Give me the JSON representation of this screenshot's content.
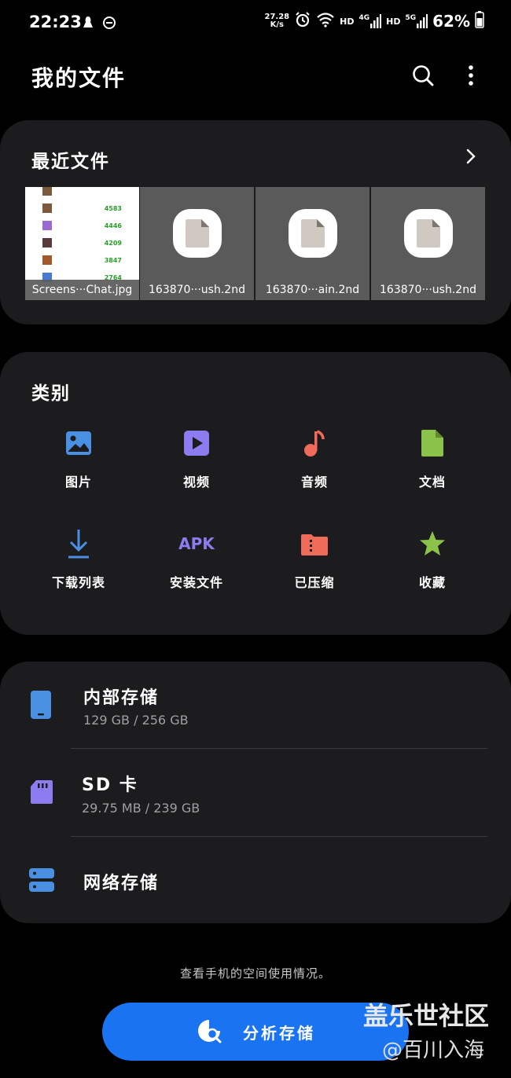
{
  "status": {
    "time": "22:23",
    "net_speed_value": "27.28",
    "net_speed_unit": "K/s",
    "hd1": "HD",
    "sig1": "4G",
    "hd2": "HD",
    "sig2": "5G",
    "battery": "62%"
  },
  "header": {
    "title": "我的文件"
  },
  "recent": {
    "title": "最近文件",
    "files": [
      {
        "name": "Screens···Chat.jpg"
      },
      {
        "name": "163870···ush.2nd"
      },
      {
        "name": "163870···ain.2nd"
      },
      {
        "name": "163870···ush.2nd"
      }
    ],
    "screenshot_scores": [
      "4583",
      "4446",
      "4209",
      "3847",
      "2764"
    ]
  },
  "categories": {
    "title": "类别",
    "items": [
      {
        "label": "图片",
        "icon": "image-icon",
        "color": "#4a90e2"
      },
      {
        "label": "视频",
        "icon": "video-icon",
        "color": "#8b7cf0"
      },
      {
        "label": "音频",
        "icon": "music-icon",
        "color": "#f06b5a"
      },
      {
        "label": "文档",
        "icon": "document-icon",
        "color": "#8bc34a"
      },
      {
        "label": "下载列表",
        "icon": "download-icon",
        "color": "#4a90e2"
      },
      {
        "label": "安装文件",
        "icon": "apk-icon",
        "icon_text": "APK",
        "color": "#8b7cf0"
      },
      {
        "label": "已压缩",
        "icon": "archive-icon",
        "color": "#f06b5a"
      },
      {
        "label": "收藏",
        "icon": "star-icon",
        "color": "#8bc34a"
      }
    ]
  },
  "storage": {
    "internal": {
      "name": "内部存储",
      "usage": "129 GB / 256 GB",
      "color": "#4a90e2"
    },
    "sd": {
      "name": "SD 卡",
      "usage": "29.75 MB / 239 GB",
      "color": "#8b7cf0"
    },
    "network": {
      "name": "网络存储",
      "color": "#4a90e2"
    }
  },
  "footer": {
    "hint": "查看手机的空间使用情况。",
    "analyze_label": "分析存储"
  },
  "watermark": {
    "line1": "盖乐世社区",
    "line2": "@百川入海"
  }
}
